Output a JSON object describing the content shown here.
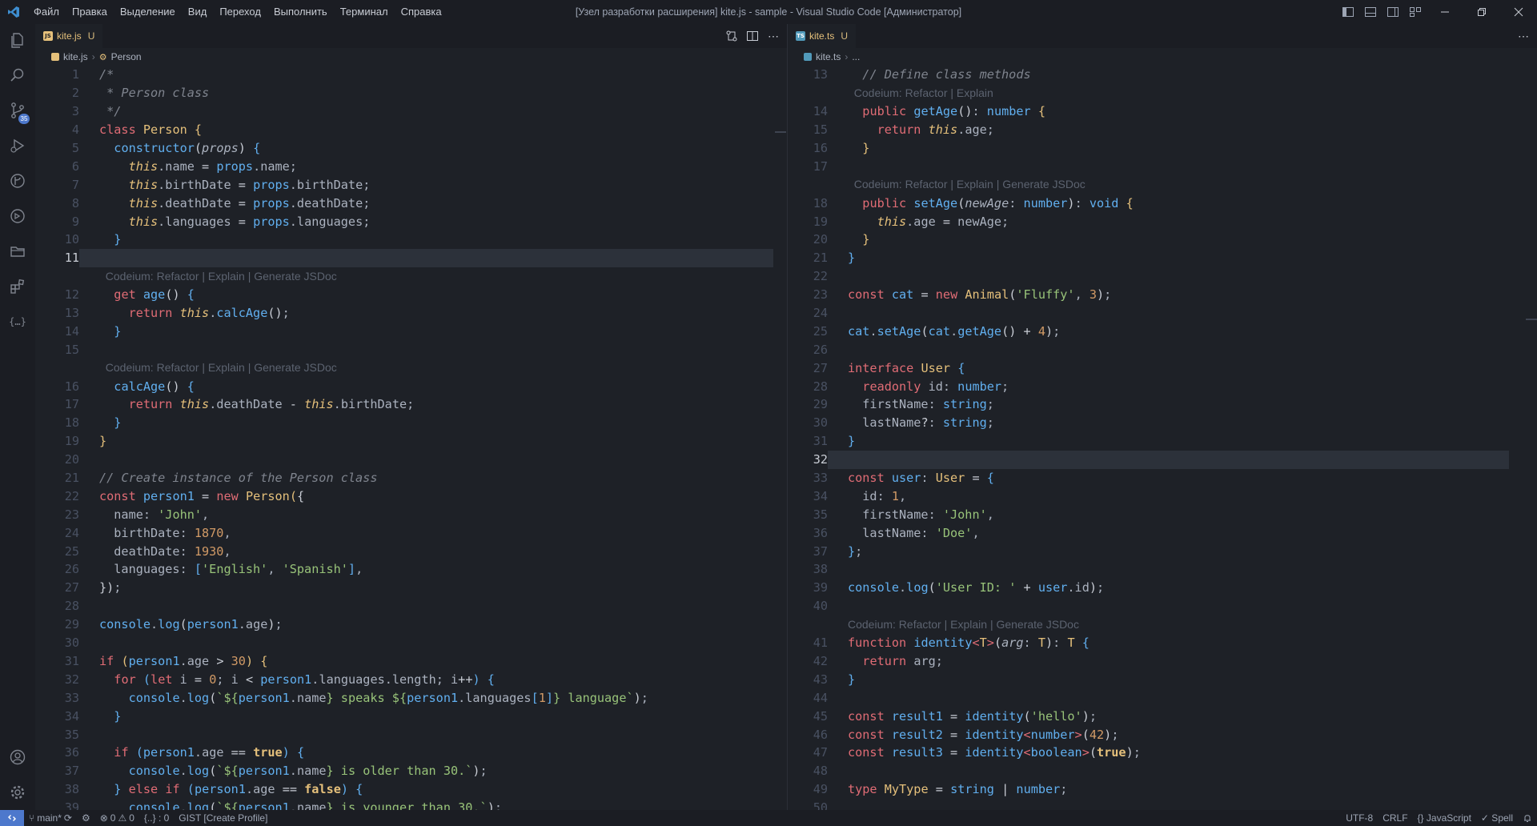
{
  "titlebar": {
    "menu": [
      "Файл",
      "Правка",
      "Выделение",
      "Вид",
      "Переход",
      "Выполнить",
      "Терминал",
      "Справка"
    ],
    "title": "[Узел разработки расширения] kite.js - sample - Visual Studio Code [Администратор]"
  },
  "activitybar": {
    "source_control_badge": "35"
  },
  "left": {
    "tab": {
      "label": "kite.js",
      "status": "U",
      "icon": "JS"
    },
    "breadcrumb": {
      "file": "kite.js",
      "symbol": "Person"
    },
    "lines": [
      {
        "n": "1",
        "h": "<span class='c'>/*</span>"
      },
      {
        "n": "2",
        "h": "<span class='c'> * Person class</span>"
      },
      {
        "n": "3",
        "h": "<span class='c'> */</span>"
      },
      {
        "n": "4",
        "h": "<span class='k'>class</span> <span class='t'>Person</span> <span class='t'>{</span>"
      },
      {
        "n": "5",
        "h": "  <span class='f'>constructor</span><span class='p'>(</span><span class='i'>props</span><span class='p'>)</span> <span class='f'>{</span>"
      },
      {
        "n": "6",
        "h": "    <span class='i t'>this</span>.name <span class='p'>=</span> <span class='f'>props</span>.name;"
      },
      {
        "n": "7",
        "h": "    <span class='i t'>this</span>.birthDate <span class='p'>=</span> <span class='f'>props</span>.birthDate;"
      },
      {
        "n": "8",
        "h": "    <span class='i t'>this</span>.deathDate <span class='p'>=</span> <span class='f'>props</span>.deathDate;"
      },
      {
        "n": "9",
        "h": "    <span class='i t'>this</span>.languages <span class='p'>=</span> <span class='f'>props</span>.languages;"
      },
      {
        "n": "10",
        "h": "  <span class='f'>}</span>"
      },
      {
        "n": "11",
        "h": "",
        "current": true
      },
      {
        "lens": "  Codeium: Refactor | Explain | Generate JSDoc"
      },
      {
        "n": "12",
        "h": "  <span class='k'>get</span> <span class='f'>age</span><span class='p'>()</span> <span class='f'>{</span>"
      },
      {
        "n": "13",
        "h": "    <span class='k'>return</span> <span class='i t'>this</span>.<span class='f'>calcAge</span><span class='p'>()</span>;"
      },
      {
        "n": "14",
        "h": "  <span class='f'>}</span>"
      },
      {
        "n": "15",
        "h": ""
      },
      {
        "lens": "  Codeium: Refactor | Explain | Generate JSDoc"
      },
      {
        "n": "16",
        "h": "  <span class='f'>calcAge</span><span class='p'>()</span> <span class='f'>{</span>"
      },
      {
        "n": "17",
        "h": "    <span class='k'>return</span> <span class='i t'>this</span>.deathDate <span class='p'>-</span> <span class='i t'>this</span>.birthDate;"
      },
      {
        "n": "18",
        "h": "  <span class='f'>}</span>"
      },
      {
        "n": "19",
        "h": "<span class='t'>}</span>"
      },
      {
        "n": "20",
        "h": ""
      },
      {
        "n": "21",
        "h": "<span class='c'>// Create instance of the Person class</span>"
      },
      {
        "n": "22",
        "h": "<span class='k'>const</span> <span class='f'>person1</span> <span class='p'>=</span> <span class='k'>new</span> <span class='t'>Person</span><span class='t'>(</span><span class='p'>{</span>"
      },
      {
        "n": "23",
        "h": "  name: <span class='s'>'John'</span>,"
      },
      {
        "n": "24",
        "h": "  birthDate: <span class='n'>1870</span>,"
      },
      {
        "n": "25",
        "h": "  deathDate: <span class='n'>1930</span>,"
      },
      {
        "n": "26",
        "h": "  languages: <span class='f'>[</span><span class='s'>'English'</span>, <span class='s'>'Spanish'</span><span class='f'>]</span>,"
      },
      {
        "n": "27",
        "h": "<span class='p'>})</span>;"
      },
      {
        "n": "28",
        "h": ""
      },
      {
        "n": "29",
        "h": "<span class='f'>console</span>.<span class='f'>log</span><span class='p'>(</span><span class='f'>person1</span>.age<span class='p'>)</span>;"
      },
      {
        "n": "30",
        "h": ""
      },
      {
        "n": "31",
        "h": "<span class='k'>if</span> <span class='t'>(</span><span class='f'>person1</span>.age <span class='p'>&gt;</span> <span class='n'>30</span><span class='t'>)</span> <span class='t'>{</span>"
      },
      {
        "n": "32",
        "h": "  <span class='k'>for</span> <span class='f'>(</span><span class='k'>let</span> i <span class='p'>=</span> <span class='n'>0</span>; i <span class='p'>&lt;</span> <span class='f'>person1</span>.languages.length; i<span class='p'>++</span><span class='f'>)</span> <span class='f'>{</span>"
      },
      {
        "n": "33",
        "h": "    <span class='f'>console</span>.<span class='f'>log</span><span class='p'>(</span><span class='s'>`${</span><span class='f'>person1</span>.name<span class='s'>} speaks ${</span><span class='f'>person1</span>.languages<span class='f'>[</span><span class='n'>1</span><span class='f'>]</span><span class='s'>} language`</span><span class='p'>)</span>;"
      },
      {
        "n": "34",
        "h": "  <span class='f'>}</span>"
      },
      {
        "n": "35",
        "h": ""
      },
      {
        "n": "36",
        "h": "  <span class='k'>if</span> <span class='f'>(</span><span class='f'>person1</span>.age <span class='p'>==</span> <span class='b'>true</span><span class='f'>)</span> <span class='f'>{</span>"
      },
      {
        "n": "37",
        "h": "    <span class='f'>console</span>.<span class='f'>log</span><span class='p'>(</span><span class='s'>`${</span><span class='f'>person1</span>.name<span class='s'>} is older than 30.`</span><span class='p'>)</span>;"
      },
      {
        "n": "38",
        "h": "  <span class='f'>}</span> <span class='k'>else</span> <span class='k'>if</span> <span class='f'>(</span><span class='f'>person1</span>.age <span class='p'>==</span> <span class='b'>false</span><span class='f'>)</span> <span class='f'>{</span>"
      },
      {
        "n": "39",
        "h": "    <span class='f'>console</span>.<span class='f'>log</span><span class='p'>(</span><span class='s'>`${</span><span class='f'>person1</span>.name<span class='s'>} is younger than 30.`</span><span class='p'>)</span>;"
      }
    ]
  },
  "right": {
    "tab": {
      "label": "kite.ts",
      "status": "U",
      "icon": "TS"
    },
    "breadcrumb": {
      "file": "kite.ts",
      "symbol": "..."
    },
    "lines": [
      {
        "n": "13",
        "h": "  <span class='c'>// Define class methods</span>"
      },
      {
        "lens": "  Codeium: Refactor | Explain"
      },
      {
        "n": "14",
        "h": "  <span class='k'>public</span> <span class='f'>getAge</span><span class='p'>()</span>: <span class='f'>number</span> <span class='t'>{</span>"
      },
      {
        "n": "15",
        "h": "    <span class='k'>return</span> <span class='i t'>this</span>.age;"
      },
      {
        "n": "16",
        "h": "  <span class='t'>}</span>"
      },
      {
        "n": "17",
        "h": ""
      },
      {
        "lens": "  Codeium: Refactor | Explain | Generate JSDoc"
      },
      {
        "n": "18",
        "h": "  <span class='k'>public</span> <span class='f'>setAge</span><span class='p'>(</span><span class='i'>newAge</span>: <span class='f'>number</span><span class='p'>)</span>: <span class='f'>void</span> <span class='t'>{</span>"
      },
      {
        "n": "19",
        "h": "    <span class='i t'>this</span>.age <span class='p'>=</span> newAge;"
      },
      {
        "n": "20",
        "h": "  <span class='t'>}</span>"
      },
      {
        "n": "21",
        "h": "<span class='f'>}</span>"
      },
      {
        "n": "22",
        "h": ""
      },
      {
        "n": "23",
        "h": "<span class='k'>const</span> <span class='f'>cat</span> <span class='p'>=</span> <span class='k'>new</span> <span class='t'>Animal</span><span class='p'>(</span><span class='s'>'Fluffy'</span>, <span class='n'>3</span><span class='p'>)</span>;"
      },
      {
        "n": "24",
        "h": ""
      },
      {
        "n": "25",
        "h": "<span class='f'>cat</span>.<span class='f'>setAge</span><span class='p'>(</span><span class='f'>cat</span>.<span class='f'>getAge</span><span class='p'>()</span> <span class='p'>+</span> <span class='n'>4</span><span class='p'>)</span>;"
      },
      {
        "n": "26",
        "h": ""
      },
      {
        "n": "27",
        "h": "<span class='k'>interface</span> <span class='t'>User</span> <span class='f'>{</span>"
      },
      {
        "n": "28",
        "h": "  <span class='k'>readonly</span> id: <span class='f'>number</span>;"
      },
      {
        "n": "29",
        "h": "  firstName: <span class='f'>string</span>;"
      },
      {
        "n": "30",
        "h": "  lastName<span class='p'>?</span>: <span class='f'>string</span>;"
      },
      {
        "n": "31",
        "h": "<span class='f'>}</span>"
      },
      {
        "n": "32",
        "h": "",
        "current": true
      },
      {
        "n": "33",
        "h": "<span class='k'>const</span> <span class='f'>user</span>: <span class='t'>User</span> <span class='p'>=</span> <span class='f'>{</span>"
      },
      {
        "n": "34",
        "h": "  id: <span class='n'>1</span>,"
      },
      {
        "n": "35",
        "h": "  firstName: <span class='s'>'John'</span>,"
      },
      {
        "n": "36",
        "h": "  lastName: <span class='s'>'Doe'</span>,"
      },
      {
        "n": "37",
        "h": "<span class='f'>}</span>;"
      },
      {
        "n": "38",
        "h": ""
      },
      {
        "n": "39",
        "h": "<span class='f'>console</span>.<span class='f'>log</span><span class='p'>(</span><span class='s'>'User ID: '</span> <span class='p'>+</span> <span class='f'>user</span>.id<span class='p'>)</span>;"
      },
      {
        "n": "40",
        "h": ""
      },
      {
        "lens": "Codeium: Refactor | Explain | Generate JSDoc"
      },
      {
        "n": "41",
        "h": "<span class='k'>function</span> <span class='f'>identity</span><span class='k'>&lt;</span><span class='t'>T</span><span class='k'>&gt;</span><span class='p'>(</span><span class='i'>arg</span>: <span class='t'>T</span><span class='p'>)</span>: <span class='t'>T</span> <span class='f'>{</span>"
      },
      {
        "n": "42",
        "h": "  <span class='k'>return</span> arg;"
      },
      {
        "n": "43",
        "h": "<span class='f'>}</span>"
      },
      {
        "n": "44",
        "h": ""
      },
      {
        "n": "45",
        "h": "<span class='k'>const</span> <span class='f'>result1</span> <span class='p'>=</span> <span class='f'>identity</span><span class='p'>(</span><span class='s'>'hello'</span><span class='p'>)</span>;"
      },
      {
        "n": "46",
        "h": "<span class='k'>const</span> <span class='f'>result2</span> <span class='p'>=</span> <span class='f'>identity</span><span class='k'>&lt;</span><span class='f'>number</span><span class='k'>&gt;</span><span class='p'>(</span><span class='n'>42</span><span class='p'>)</span>;"
      },
      {
        "n": "47",
        "h": "<span class='k'>const</span> <span class='f'>result3</span> <span class='p'>=</span> <span class='f'>identity</span><span class='k'>&lt;</span><span class='f'>boolean</span><span class='k'>&gt;</span><span class='p'>(</span><span class='b'>true</span><span class='p'>)</span>;"
      },
      {
        "n": "48",
        "h": ""
      },
      {
        "n": "49",
        "h": "<span class='k'>type</span> <span class='t'>MyType</span> <span class='p'>=</span> <span class='f'>string</span> <span class='p'>|</span> <span class='f'>number</span>;"
      },
      {
        "n": "50",
        "h": ""
      }
    ]
  },
  "statusbar": {
    "branch": "main*",
    "errors": "0",
    "warnings": "0",
    "selection": "{..} : 0",
    "gist": "GIST [Create Profile]",
    "encoding": "UTF-8",
    "eol": "CRLF",
    "language": "{} JavaScript",
    "spell": "✓ Spell"
  },
  "colors": {
    "accent": "#4d78cc",
    "background": "#1e2127",
    "chrome": "#1b1d23"
  }
}
